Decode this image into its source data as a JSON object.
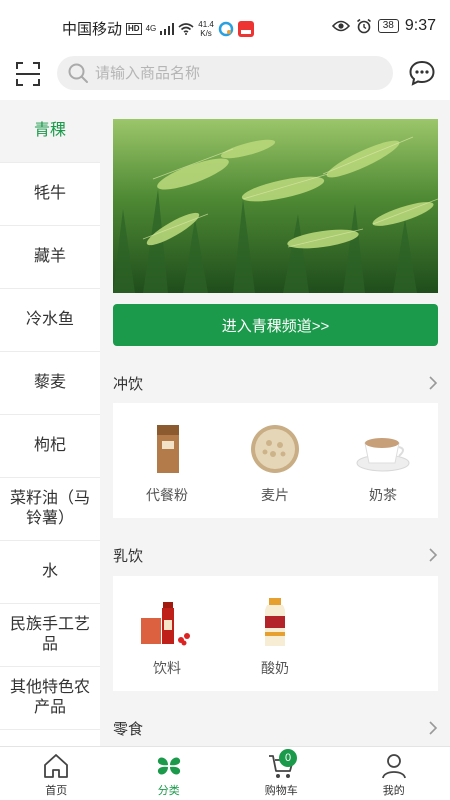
{
  "status_bar": {
    "carrier": "中国移动",
    "hd": "HD",
    "network": "4G",
    "speed_value": "41.4",
    "speed_unit": "K/s",
    "battery": "38",
    "time": "9:37"
  },
  "header": {
    "search_placeholder": "请输入商品名称"
  },
  "sidebar": {
    "items": [
      {
        "label": "青稞",
        "active": true
      },
      {
        "label": "牦牛"
      },
      {
        "label": "藏羊"
      },
      {
        "label": "冷水鱼"
      },
      {
        "label": "藜麦"
      },
      {
        "label": "枸杞"
      },
      {
        "label": "菜籽油（马铃薯）"
      },
      {
        "label": "水"
      },
      {
        "label": "民族手工艺品"
      },
      {
        "label": "其他特色农产品"
      }
    ]
  },
  "main": {
    "channel_button": "进入青稞频道>>",
    "sections": [
      {
        "title": "冲饮",
        "products": [
          {
            "name": "代餐粉"
          },
          {
            "name": "麦片"
          },
          {
            "name": "奶茶"
          }
        ]
      },
      {
        "title": "乳饮",
        "products": [
          {
            "name": "饮料"
          },
          {
            "name": "酸奶"
          }
        ]
      },
      {
        "title": "零食",
        "products": []
      }
    ]
  },
  "bottom_nav": {
    "items": [
      {
        "label": "首页",
        "icon": "home-icon"
      },
      {
        "label": "分类",
        "icon": "category-icon",
        "active": true
      },
      {
        "label": "购物车",
        "icon": "cart-icon",
        "badge": "0"
      },
      {
        "label": "我的",
        "icon": "profile-icon"
      }
    ]
  },
  "colors": {
    "accent": "#1a9a4a",
    "background": "#f4f4f4"
  }
}
